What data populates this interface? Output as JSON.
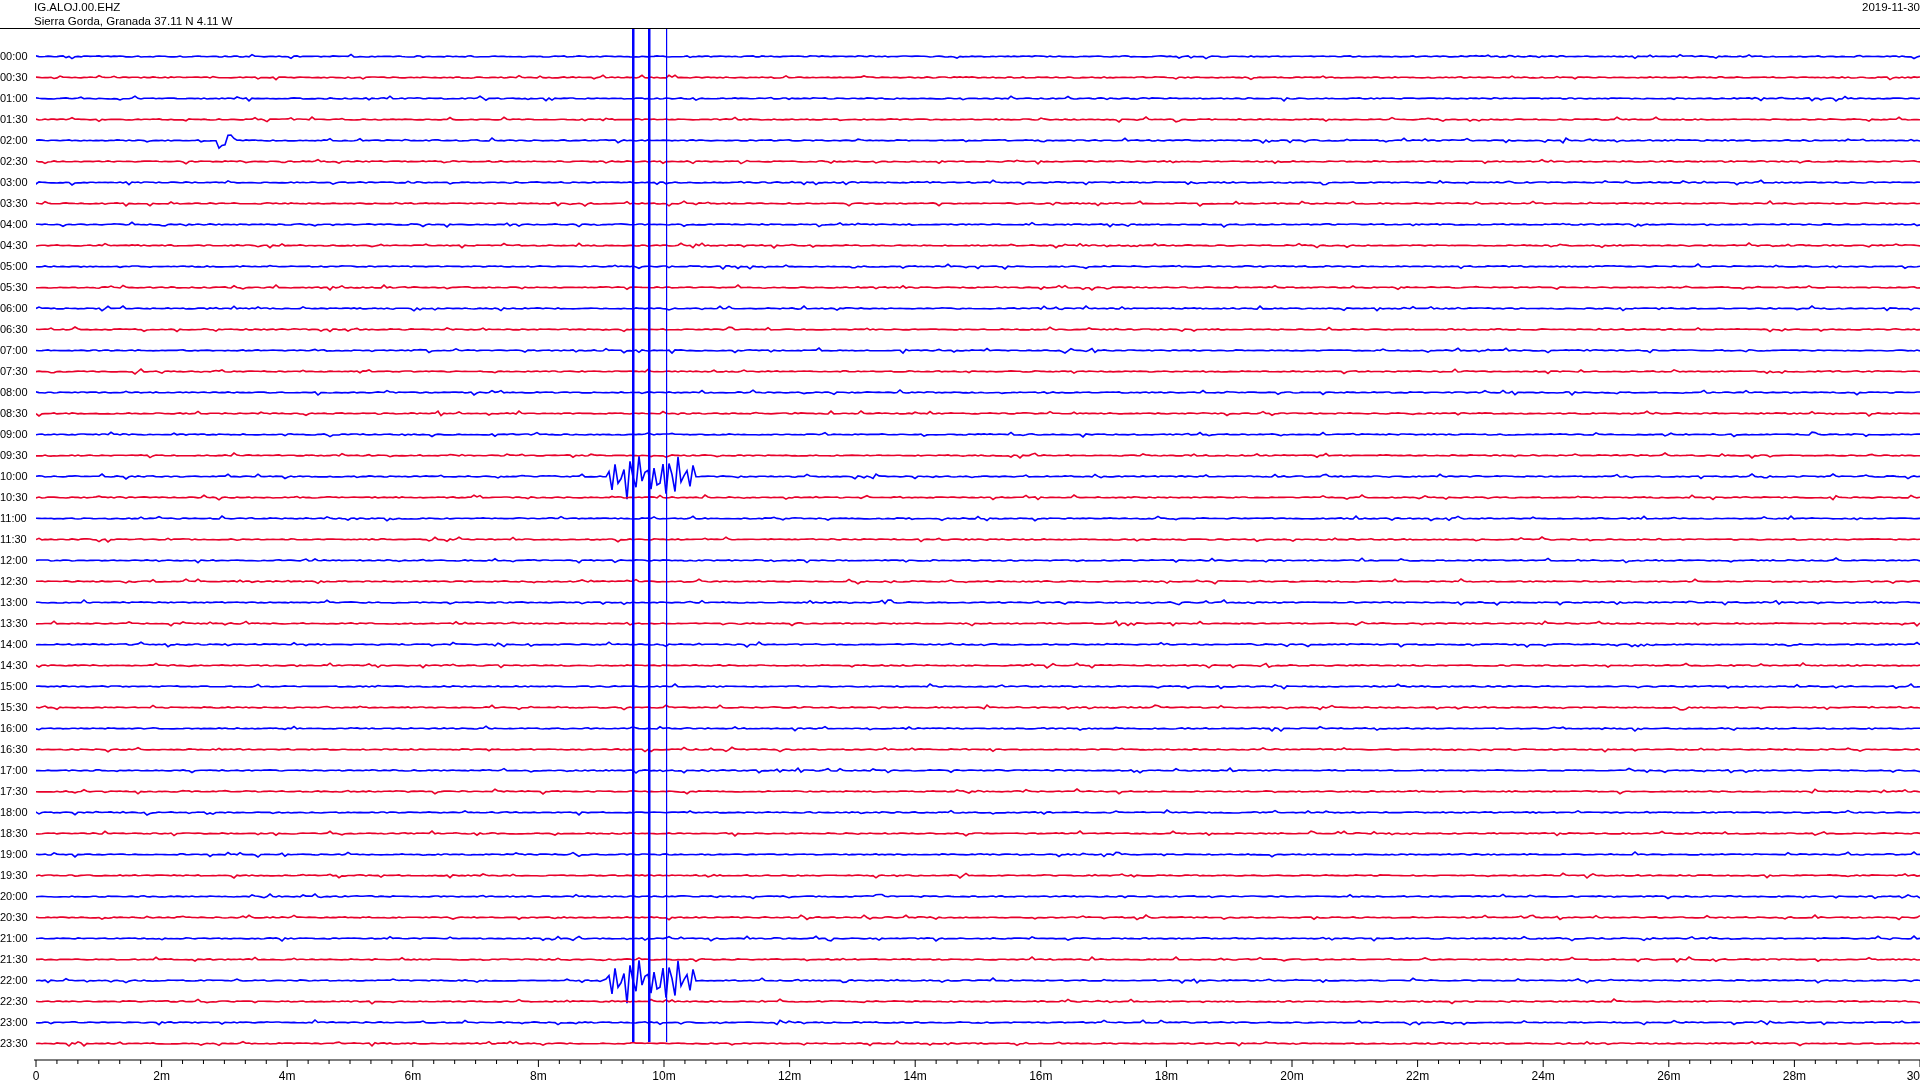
{
  "header": {
    "station": "IG.ALOJ.00.EHZ",
    "location": "Sierra Gorda, Granada  37.11 N 4.11 W",
    "date": "2019-11-30"
  },
  "rows": [
    {
      "time": "00:00",
      "color": "#0000ff"
    },
    {
      "time": "00:30",
      "color": "#e8002a"
    },
    {
      "time": "01:00",
      "color": "#0000ff"
    },
    {
      "time": "01:30",
      "color": "#e8002a"
    },
    {
      "time": "02:00",
      "color": "#0000ff"
    },
    {
      "time": "02:30",
      "color": "#e8002a"
    },
    {
      "time": "03:00",
      "color": "#0000ff"
    },
    {
      "time": "03:30",
      "color": "#e8002a"
    },
    {
      "time": "04:00",
      "color": "#0000ff"
    },
    {
      "time": "04:30",
      "color": "#e8002a"
    },
    {
      "time": "05:00",
      "color": "#0000ff"
    },
    {
      "time": "05:30",
      "color": "#e8002a"
    },
    {
      "time": "06:00",
      "color": "#0000ff"
    },
    {
      "time": "06:30",
      "color": "#e8002a"
    },
    {
      "time": "07:00",
      "color": "#0000ff"
    },
    {
      "time": "07:30",
      "color": "#e8002a"
    },
    {
      "time": "08:00",
      "color": "#0000ff"
    },
    {
      "time": "08:30",
      "color": "#e8002a"
    },
    {
      "time": "09:00",
      "color": "#0000ff"
    },
    {
      "time": "09:30",
      "color": "#e8002a"
    },
    {
      "time": "10:00",
      "color": "#0000ff"
    },
    {
      "time": "10:30",
      "color": "#e8002a"
    },
    {
      "time": "11:00",
      "color": "#0000ff"
    },
    {
      "time": "11:30",
      "color": "#e8002a"
    },
    {
      "time": "12:00",
      "color": "#0000ff"
    },
    {
      "time": "12:30",
      "color": "#e8002a"
    },
    {
      "time": "13:00",
      "color": "#0000ff"
    },
    {
      "time": "13:30",
      "color": "#e8002a"
    },
    {
      "time": "14:00",
      "color": "#0000ff"
    },
    {
      "time": "14:30",
      "color": "#e8002a"
    },
    {
      "time": "15:00",
      "color": "#0000ff"
    },
    {
      "time": "15:30",
      "color": "#e8002a"
    },
    {
      "time": "16:00",
      "color": "#0000ff"
    },
    {
      "time": "16:30",
      "color": "#e8002a"
    },
    {
      "time": "17:00",
      "color": "#0000ff"
    },
    {
      "time": "17:30",
      "color": "#e8002a"
    },
    {
      "time": "18:00",
      "color": "#0000ff"
    },
    {
      "time": "18:30",
      "color": "#e8002a"
    },
    {
      "time": "19:00",
      "color": "#0000ff"
    },
    {
      "time": "19:30",
      "color": "#e8002a"
    },
    {
      "time": "20:00",
      "color": "#0000ff"
    },
    {
      "time": "20:30",
      "color": "#e8002a"
    },
    {
      "time": "21:00",
      "color": "#0000ff"
    },
    {
      "time": "21:30",
      "color": "#e8002a"
    },
    {
      "time": "22:00",
      "color": "#0000ff"
    },
    {
      "time": "22:30",
      "color": "#e8002a"
    },
    {
      "time": "23:00",
      "color": "#0000ff"
    },
    {
      "time": "23:30",
      "color": "#e8002a"
    }
  ],
  "x_axis": {
    "labels": [
      "0",
      "2m",
      "4m",
      "6m",
      "8m",
      "10m",
      "12m",
      "14m",
      "16m",
      "18m",
      "20m",
      "22m",
      "24m",
      "26m",
      "28m",
      "30"
    ]
  }
}
